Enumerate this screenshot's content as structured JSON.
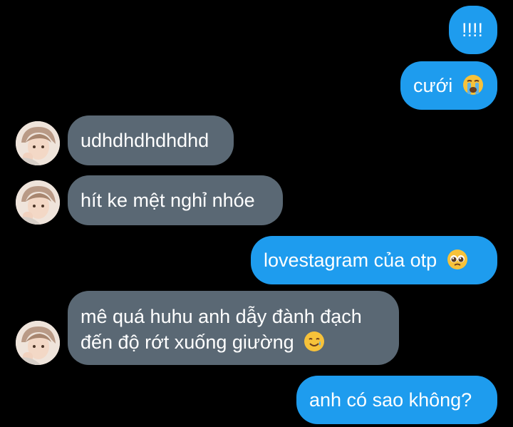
{
  "colors": {
    "background": "#000000",
    "outgoing_bubble": "#1e9cee",
    "incoming_bubble": "#5a6874",
    "text": "#ffffff"
  },
  "messages": [
    {
      "direction": "outgoing",
      "text": "!!!!"
    },
    {
      "direction": "outgoing",
      "text": "cưới",
      "emoji": "loudly-crying-face"
    },
    {
      "direction": "incoming",
      "text": "udhdhdhdhdhd",
      "avatar": "contact-avatar"
    },
    {
      "direction": "incoming",
      "text": "hít ke mệt nghỉ nhóe",
      "avatar": "contact-avatar"
    },
    {
      "direction": "outgoing",
      "text": "lovestagram của otp",
      "emoji": "pleading-face"
    },
    {
      "direction": "incoming",
      "lines": [
        "mê quá huhu anh dẫy đành đạch",
        "đến độ rớt xuống giường"
      ],
      "emoji": "smiling-face-with-tear",
      "avatar": "contact-avatar"
    },
    {
      "direction": "outgoing",
      "text": "anh có sao không?"
    }
  ]
}
